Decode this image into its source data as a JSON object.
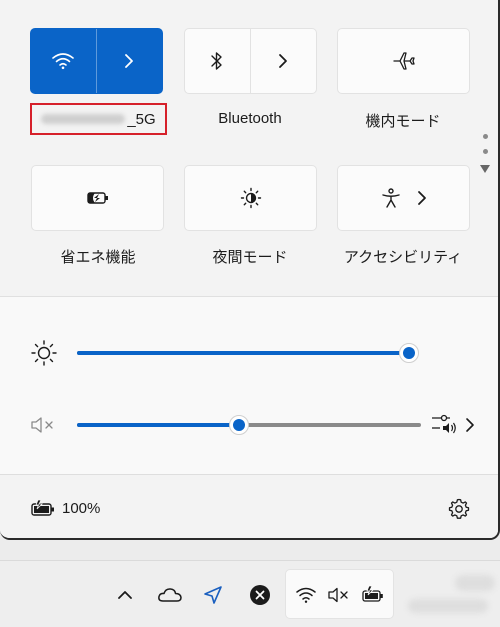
{
  "tiles": {
    "wifi": {
      "ssid_suffix": "_5G",
      "icon": "wifi-icon",
      "active": true
    },
    "bluetooth": {
      "label": "Bluetooth",
      "icon": "bluetooth-icon"
    },
    "airplane": {
      "label": "機内モード",
      "icon": "airplane-icon"
    },
    "battery_saver": {
      "label": "省エネ機能",
      "icon": "battery-saver-icon"
    },
    "night_light": {
      "label": "夜間モード",
      "icon": "night-light-icon"
    },
    "accessibility": {
      "label": "アクセシビリティ",
      "icon": "accessibility-icon"
    }
  },
  "sliders": {
    "brightness": {
      "icon": "brightness-icon",
      "level": 1.0
    },
    "volume": {
      "icon": "speaker-muted-icon",
      "level": 0.47
    }
  },
  "footer": {
    "battery_text": "100%",
    "icon": "battery-charging-icon",
    "settings_icon": "gear-icon"
  },
  "taskbar": {
    "icons": [
      "chevron-up-icon",
      "onedrive-cloud-icon",
      "location-icon",
      "close-circle-icon",
      "wifi-icon",
      "speaker-muted-icon",
      "battery-charging-icon"
    ]
  },
  "colors": {
    "accent": "#0a64c8",
    "highlight": "#d6202a"
  }
}
